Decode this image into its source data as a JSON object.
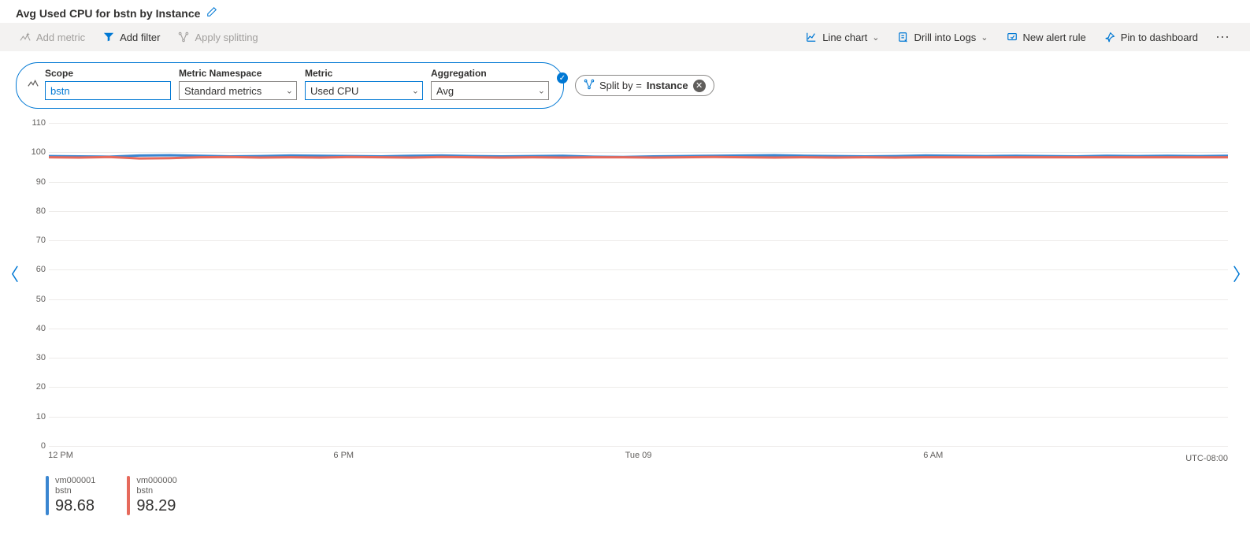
{
  "title": "Avg Used CPU for bstn by Instance",
  "toolbar": {
    "left": {
      "add_metric": "Add metric",
      "add_filter": "Add filter",
      "apply_splitting": "Apply splitting"
    },
    "right": {
      "line_chart": "Line chart",
      "drill_into_logs": "Drill into Logs",
      "new_alert_rule": "New alert rule",
      "pin_to_dashboard": "Pin to dashboard"
    }
  },
  "selectors": {
    "scope": {
      "label": "Scope",
      "value": "bstn"
    },
    "ns": {
      "label": "Metric Namespace",
      "value": "Standard metrics"
    },
    "metric": {
      "label": "Metric",
      "value": "Used CPU"
    },
    "agg": {
      "label": "Aggregation",
      "value": "Avg"
    }
  },
  "split_chip": {
    "prefix": "Split by = ",
    "value": "Instance"
  },
  "timezone": "UTC-08:00",
  "legend": [
    {
      "name": "vm000001",
      "sub": "bstn",
      "value": "98.68",
      "color": "#3a86d1"
    },
    {
      "name": "vm000000",
      "sub": "bstn",
      "value": "98.29",
      "color": "#e66a5c"
    }
  ],
  "chart_data": {
    "type": "line",
    "title": "Avg Used CPU for bstn by Instance",
    "xlabel": "",
    "ylabel": "",
    "ylim": [
      0,
      110
    ],
    "y_ticks": [
      0,
      10,
      20,
      30,
      40,
      50,
      60,
      70,
      80,
      90,
      100,
      110
    ],
    "x_ticks": [
      "12 PM",
      "6 PM",
      "Tue 09",
      "6 AM"
    ],
    "x_tick_positions_pct": [
      1,
      25,
      50,
      75
    ],
    "series": [
      {
        "name": "vm000001",
        "color": "#3a86d1",
        "points": [
          98.7,
          98.6,
          98.5,
          98.9,
          99.0,
          98.8,
          98.6,
          98.7,
          98.9,
          98.8,
          98.7,
          98.6,
          98.8,
          98.9,
          98.7,
          98.6,
          98.7,
          98.8,
          98.5,
          98.4,
          98.6,
          98.7,
          98.8,
          98.9,
          99.0,
          98.8,
          98.7,
          98.6,
          98.7,
          98.9,
          98.8,
          98.7,
          98.8,
          98.7,
          98.6,
          98.8,
          98.7,
          98.8,
          98.7,
          98.8
        ]
      },
      {
        "name": "vm000000",
        "color": "#e66a5c",
        "points": [
          98.3,
          98.2,
          98.4,
          97.9,
          98.0,
          98.3,
          98.4,
          98.2,
          98.3,
          98.2,
          98.4,
          98.3,
          98.2,
          98.4,
          98.3,
          98.2,
          98.3,
          98.2,
          98.3,
          98.3,
          98.2,
          98.3,
          98.4,
          98.3,
          98.2,
          98.3,
          98.2,
          98.3,
          98.2,
          98.3,
          98.3,
          98.3,
          98.3,
          98.3,
          98.3,
          98.3,
          98.3,
          98.3,
          98.3,
          98.3
        ]
      }
    ]
  }
}
